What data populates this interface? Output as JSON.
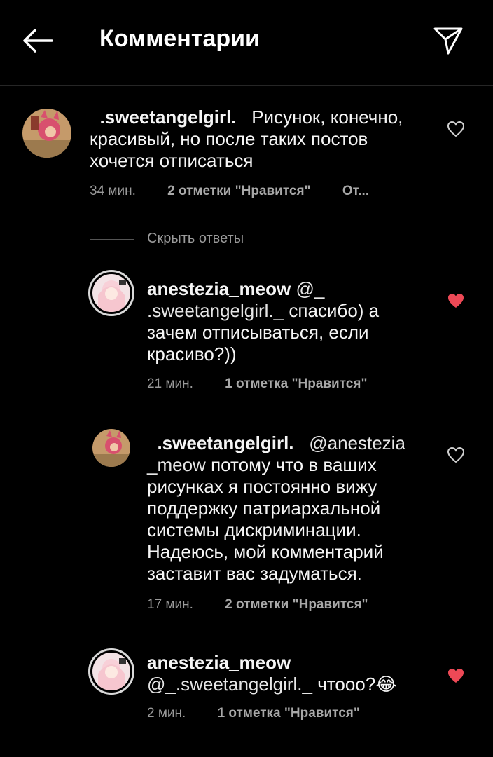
{
  "header": {
    "title": "Комментарии",
    "back_icon": "arrow-left-icon",
    "send_icon": "paper-plane-icon"
  },
  "colors": {
    "background": "#000000",
    "liked_heart": "#ed4956",
    "muted": "#9a9a9a"
  },
  "comments": [
    {
      "username": "_.sweetangelgirl._",
      "text": "Рисунок, конечно, красивый, но после таких постов хочется отписаться",
      "time": "34 мин.",
      "likes": "2 отметки \"Нравится\"",
      "reply": "От...",
      "liked": false
    }
  ],
  "hide_replies": "Скрыть ответы",
  "replies": [
    {
      "username": "anestezia_meow",
      "mention": "@_ .sweetangelgirl._",
      "text": "спасибо) а зачем отписываться, если красиво?))",
      "time": "21 мин.",
      "likes": "1 отметка \"Нравится\"",
      "liked": true
    },
    {
      "username": "_.sweetangelgirl._",
      "mention": "@anestezia _meow",
      "text": "потому что в ваших рисунках я постоянно вижу поддержку патриархальной системы дискриминации. Надеюсь, мой комментарий заставит вас задуматься.",
      "time": "17 мин.",
      "likes": "2 отметки \"Нравится\"",
      "liked": false
    },
    {
      "username": "anestezia_meow",
      "mention": "@_.sweetangelgirl._",
      "text": "чтооо?😂",
      "time": "2 мин.",
      "likes": "1 отметка \"Нравится\"",
      "liked": true
    }
  ]
}
